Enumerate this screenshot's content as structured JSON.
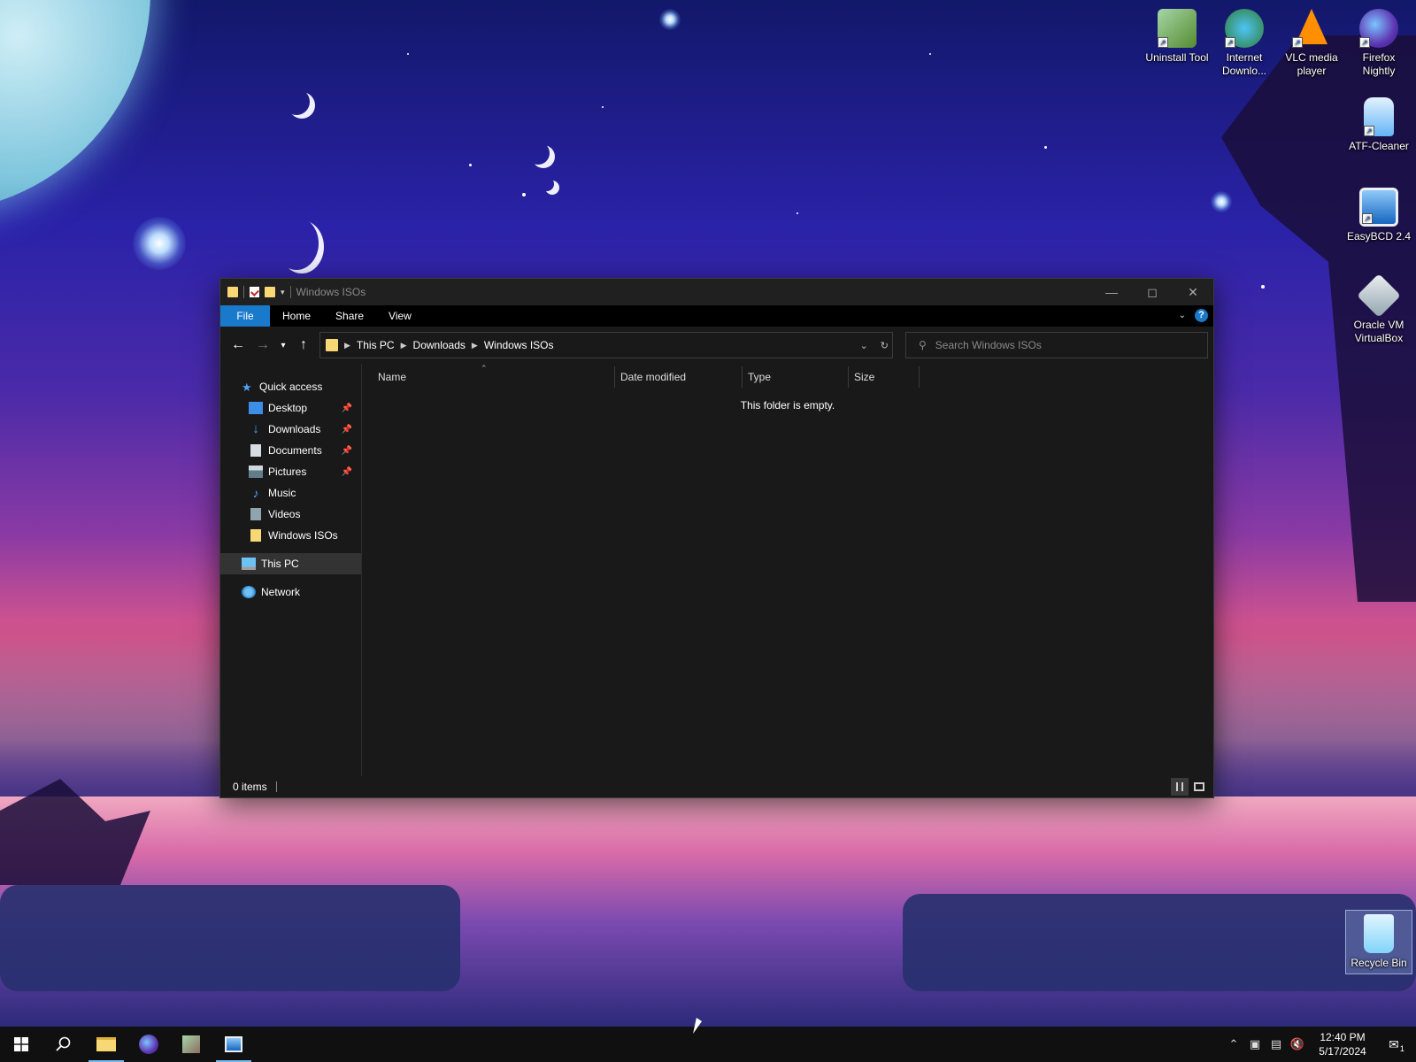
{
  "desktop": {
    "icons": [
      {
        "label": "Uninstall Tool",
        "icon": "uninstall-tool-icon",
        "color": "#7cb342"
      },
      {
        "label": "Internet Downlo...",
        "icon": "internet-download-manager-icon",
        "color": "#43a047"
      },
      {
        "label": "VLC media player",
        "icon": "vlc-icon",
        "color": "#ff8f00"
      },
      {
        "label": "Firefox Nightly",
        "icon": "firefox-nightly-icon",
        "color": "#5e35b1"
      },
      {
        "label": "ATF-Cleaner",
        "icon": "atf-cleaner-icon",
        "color": "#90caf9"
      },
      {
        "label": "EasyBCD 2.4",
        "icon": "easybcd-icon",
        "color": "#1e88e5"
      },
      {
        "label": "Oracle VM VirtualBox",
        "icon": "virtualbox-icon",
        "color": "#cfd8dc"
      },
      {
        "label": "Recycle Bin",
        "icon": "recycle-bin-icon",
        "color": "#b3e5fc"
      }
    ]
  },
  "explorer": {
    "title": "Windows ISOs",
    "ribbon_tabs": [
      "File",
      "Home",
      "Share",
      "View"
    ],
    "breadcrumb": [
      "This PC",
      "Downloads",
      "Windows ISOs"
    ],
    "search_placeholder": "Search Windows ISOs",
    "nav_pane": {
      "quick_access": "Quick access",
      "pinned": [
        {
          "label": "Desktop",
          "icon": "desktop-folder-icon",
          "pinned": true
        },
        {
          "label": "Downloads",
          "icon": "downloads-folder-icon",
          "pinned": true
        },
        {
          "label": "Documents",
          "icon": "documents-folder-icon",
          "pinned": true
        },
        {
          "label": "Pictures",
          "icon": "pictures-folder-icon",
          "pinned": true
        },
        {
          "label": "Music",
          "icon": "music-folder-icon",
          "pinned": false
        },
        {
          "label": "Videos",
          "icon": "videos-folder-icon",
          "pinned": false
        },
        {
          "label": "Windows ISOs",
          "icon": "folder-icon",
          "pinned": false
        }
      ],
      "this_pc": "This PC",
      "network": "Network"
    },
    "columns": [
      "Name",
      "Date modified",
      "Type",
      "Size"
    ],
    "empty_message": "This folder is empty.",
    "status": "0 items"
  },
  "taskbar": {
    "time": "12:40 PM",
    "date": "5/17/2024",
    "notification_count": "1"
  },
  "colors": {
    "accent": "#1979ca",
    "folder": "#f8d775",
    "window_bg": "#191919"
  }
}
